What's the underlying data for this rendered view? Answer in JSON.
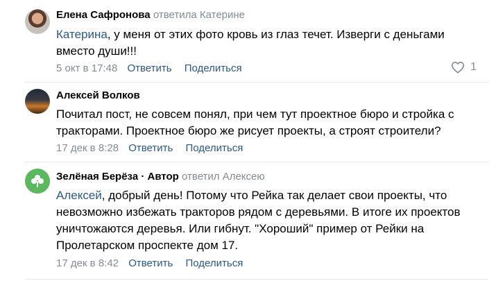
{
  "comments": [
    {
      "author": "Елена Сафронова",
      "reply_text": "ответила Катерине",
      "mention": "Катерина",
      "text": ", у меня от этих фото кровь из глаз течет. Изверги с деньгами вместо души!!!",
      "date": "5 окт в 17:48",
      "reply_label": "Ответить",
      "share_label": "Поделиться",
      "likes": "1"
    },
    {
      "author": "Алексей Волков",
      "text": "Почитал пост, не совсем понял, при чем тут проектное бюро и стройка с тракторами. Проектное бюро же рисует проекты, а строят строители?",
      "date": "17 дек в 8:28",
      "reply_label": "Ответить",
      "share_label": "Поделиться"
    },
    {
      "author": "Зелёная Берёза",
      "author_badge": " · Автор",
      "reply_text": "ответил Алексею",
      "mention": "Алексей",
      "text": ", добрый день! Потому что Рейка так делает свои проекты, что невозможно избежать тракторов рядом с деревьями. В итоге их проектов уничтожаются деревья. Или гибнут. \"Хороший\" пример от Рейки на Пролетарском проспекте дом 17.",
      "date": "17 дек в 8:42",
      "reply_label": "Ответить",
      "share_label": "Поделиться"
    }
  ],
  "colors": {
    "link": "#2a5885",
    "muted": "#818c99",
    "divider": "#e7e8ec",
    "brand_green": "#5cb85c"
  }
}
